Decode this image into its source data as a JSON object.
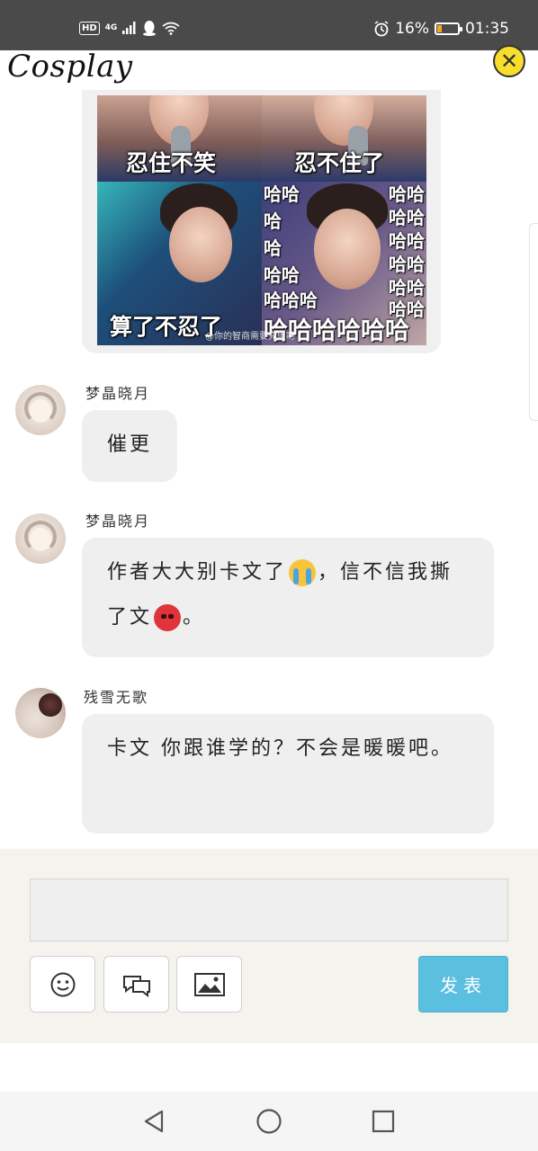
{
  "status_bar": {
    "hd_label": "HD",
    "network_label": "4G",
    "battery_percent": "16%",
    "battery_level": 0.16,
    "time": "01:35"
  },
  "header": {
    "title": "Cosplay",
    "close_icon": "close-icon",
    "close_glyph": "✕"
  },
  "image_post": {
    "captions": [
      "忍住不笑",
      "忍不住了",
      "算了不忍了"
    ],
    "laugh_text": [
      "哈哈",
      "哈",
      "哈",
      "哈哈",
      "哈哈哈",
      "哈哈哈哈哈哈"
    ],
    "laugh_text_right": [
      "哈哈",
      "哈哈",
      "哈哈",
      "哈哈",
      "哈哈",
      "哈哈"
    ],
    "watermark": "@你的智商需要充值呀"
  },
  "comments": [
    {
      "user": "梦晶晓月",
      "text": "催更"
    },
    {
      "user": "梦晶晓月",
      "text_before": "作者大大别卡文了",
      "emoji1": "loudly-crying-face",
      "text_middle": "，信不信我撕了文",
      "emoji2": "angry-face",
      "text_after": "。"
    },
    {
      "user": "残雪无歌",
      "text": "卡文 你跟谁学的？不会是暖暖吧。"
    }
  ],
  "composer": {
    "input_value": "",
    "emoji_icon": "smiley-icon",
    "chat_icon": "chat-bubbles-icon",
    "image_icon": "image-icon",
    "submit_label": "发表",
    "accent_color": "#5bbfdf"
  },
  "nav": {
    "back_icon": "back-triangle-icon",
    "home_icon": "home-circle-icon",
    "recents_icon": "recents-square-icon"
  }
}
